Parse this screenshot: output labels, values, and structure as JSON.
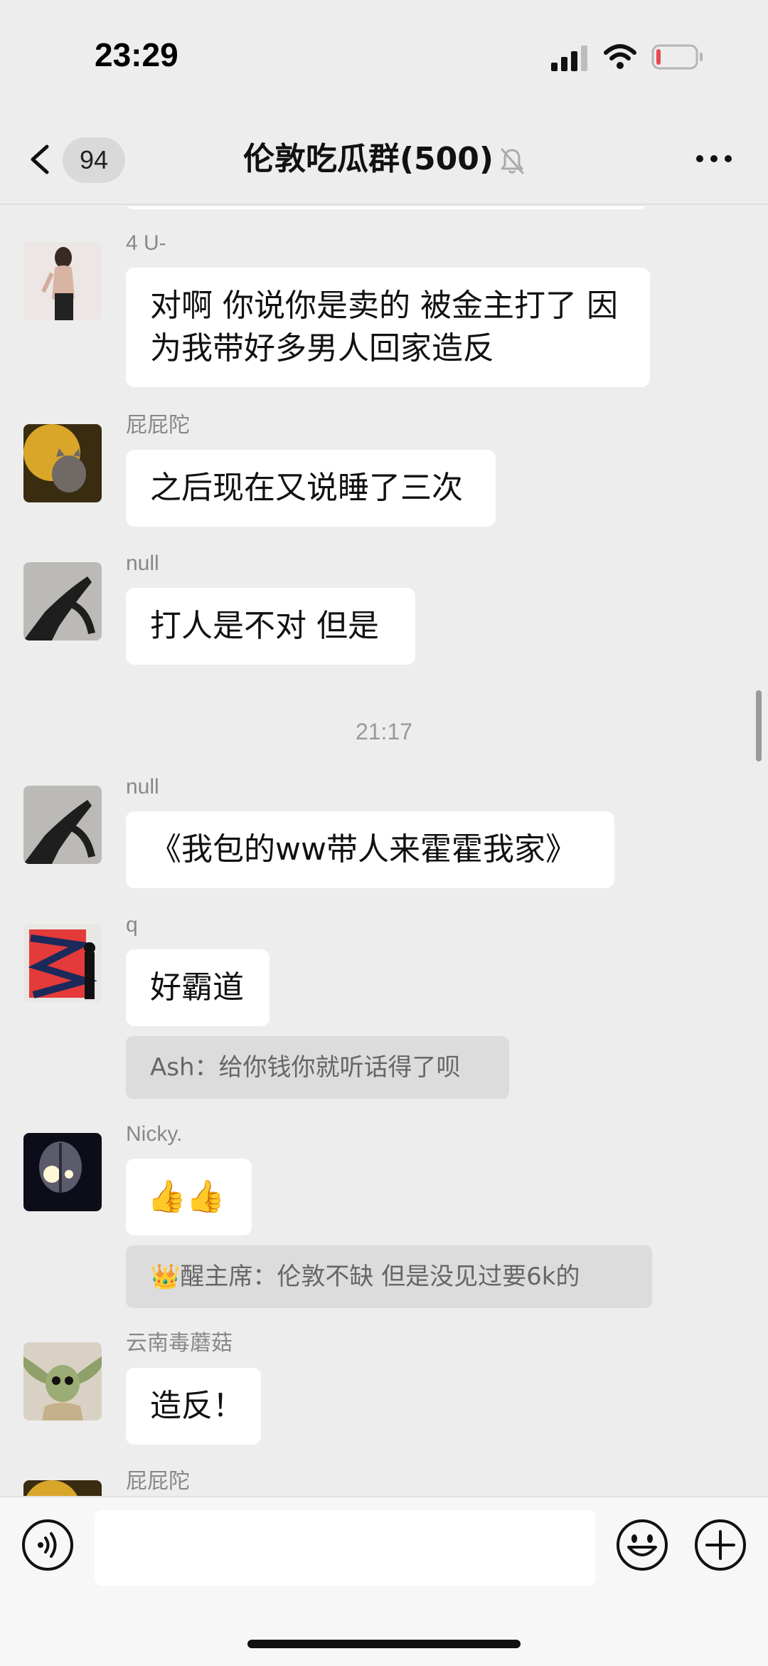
{
  "status_bar": {
    "time": "23:29"
  },
  "header": {
    "unread_count": "94",
    "title": "伦敦吃瓜群(500)"
  },
  "messages": [
    {
      "sender": "4 U-",
      "text_line1": "对啊 你说你是卖的 被金主打了 因",
      "text_line2": "为我带好多男人回家造反"
    },
    {
      "sender": "屁屁陀",
      "text": "之后现在又说睡了三次"
    },
    {
      "sender": "null",
      "text": "打人是不对 但是"
    },
    {
      "timestamp": "21:17"
    },
    {
      "sender": "null",
      "text": "《我包的ww带人来霍霍我家》"
    },
    {
      "sender": "q",
      "text": "好霸道",
      "quote": "Ash：给你钱你就听话得了呗"
    },
    {
      "sender": "Nicky.",
      "emoji": "👍👍",
      "quote": "👑醒主席：伦敦不缺 但是没见过要6k的"
    },
    {
      "sender": "云南毒蘑菇",
      "text": "造反！"
    },
    {
      "sender": "屁屁陀"
    }
  ],
  "icons": {
    "back": "chevron-left-icon",
    "mute": "bell-off-icon",
    "more": "more-dots-icon",
    "voice": "voice-icon",
    "emoji": "smiley-icon",
    "plus": "plus-circle-icon"
  },
  "colors": {
    "background": "#ededed",
    "bubble": "#ffffff",
    "quote_bg": "#dcdcdc",
    "battery_low": "#e5484d"
  }
}
